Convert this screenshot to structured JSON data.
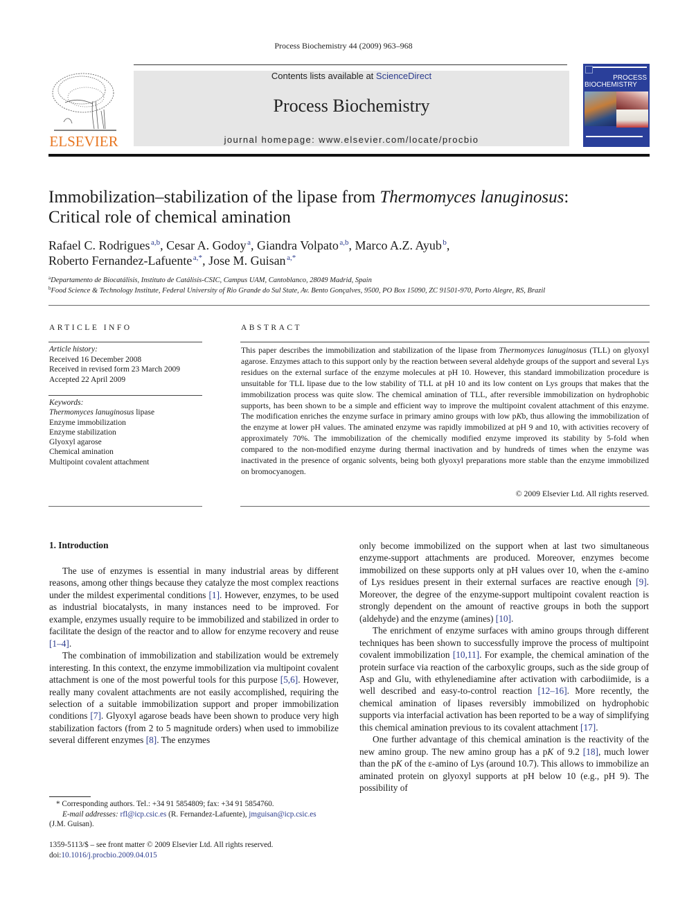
{
  "running_header": "Process Biochemistry 44 (2009) 963–968",
  "masthead": {
    "publisher_logo_text": "ELSEVIER",
    "contents_prefix": "Contents lists available at ",
    "contents_link": "ScienceDirect",
    "journal_title": "Process Biochemistry",
    "homepage": "journal homepage: www.elsevier.com/locate/procbio",
    "cover": {
      "line1": "PROCESS",
      "line2": "BIOCHEMISTRY"
    },
    "colors": {
      "logo_orange": "#e87722",
      "link_blue": "#2a3a8c",
      "box_gray": "#e6e6e6",
      "cover_blue": "#2a3f9a"
    }
  },
  "article": {
    "title_part1": "Immobilization–stabilization of the lipase from ",
    "title_italic": "Thermomyces lanuginosus",
    "title_part2": ":",
    "title_line2": "Critical role of chemical amination",
    "authors": [
      {
        "name": "Rafael C. Rodrigues",
        "sup": "a,b",
        "sep": ", "
      },
      {
        "name": "Cesar A. Godoy",
        "sup": "a",
        "sep": ", "
      },
      {
        "name": "Giandra Volpato",
        "sup": "a,b",
        "sep": ", "
      },
      {
        "name": "Marco A.Z. Ayub",
        "sup": "b",
        "sep": ","
      },
      {
        "name": "Roberto Fernandez-Lafuente",
        "sup": "a,*",
        "sep": ", "
      },
      {
        "name": "Jose M. Guisan",
        "sup": "a,*",
        "sep": ""
      }
    ],
    "affiliations": [
      {
        "key": "a",
        "text": "Departamento de Biocatálisis, Instituto de Catálisis-CSIC, Campus UAM, Cantoblanco, 28049 Madrid, Spain"
      },
      {
        "key": "b",
        "text": "Food Science & Technology Institute, Federal University of Rio Grande do Sul State, Av. Bento Gonçalves, 9500, PO Box 15090, ZC 91501-970, Porto Alegre, RS, Brazil"
      }
    ]
  },
  "article_info": {
    "heading": "ARTICLE INFO",
    "history_label": "Article history:",
    "history": [
      "Received 16 December 2008",
      "Received in revised form 23 March 2009",
      "Accepted 22 April 2009"
    ],
    "keywords_label": "Keywords:",
    "keyword_first_italic": "Thermomyces lanuginosus",
    "keyword_first_rest": " lipase",
    "keywords": [
      "Enzyme immobilization",
      "Enzyme stabilization",
      "Glyoxyl agarose",
      "Chemical amination",
      "Multipoint covalent attachment"
    ]
  },
  "abstract": {
    "heading": "ABSTRACT",
    "part1": "This paper describes the immobilization and stabilization of the lipase from ",
    "italic1": "Thermomyces lanuginosus",
    "part2": " (TLL) on glyoxyl agarose. Enzymes attach to this support only by the reaction between several aldehyde groups of the support and several Lys residues on the external surface of the enzyme molecules at pH 10. However, this standard immobilization procedure is unsuitable for TLL lipase due to the low stability of TLL at pH 10 and its low content on Lys groups that makes that the immobilization process was quite slow. The chemical amination of TLL, after reversible immobilization on hydrophobic supports, has been shown to be a simple and efficient way to improve the multipoint covalent attachment of this enzyme. The modification enriches the enzyme surface in primary amino groups with low p",
    "italic2": "K",
    "part3": "b, thus allowing the immobilization of the enzyme at lower pH values. The aminated enzyme was rapidly immobilized at pH 9 and 10, with activities recovery of approximately 70%. The immobilization of the chemically modified enzyme improved its stability by 5-fold when compared to the non-modified enzyme during thermal inactivation and by hundreds of times when the enzyme was inactivated in the presence of organic solvents, being both glyoxyl preparations more stable than the enzyme immobilized on bromocyanogen.",
    "copyright": "© 2009 Elsevier Ltd. All rights reserved."
  },
  "introduction": {
    "heading": "1. Introduction",
    "p1": [
      {
        "t": "The use of enzymes is essential in many industrial areas by different reasons, among other things because they catalyze the most complex reactions under the mildest experimental conditions "
      },
      {
        "ref": "[1]"
      },
      {
        "t": ". However, enzymes, to be used as industrial biocatalysts, in many instances need to be improved. For example, enzymes usually require to be immobilized and stabilized in order to facilitate the design of the reactor and to allow for enzyme recovery and reuse "
      },
      {
        "ref": "[1–4]"
      },
      {
        "t": "."
      }
    ],
    "p2": [
      {
        "t": "The combination of immobilization and stabilization would be extremely interesting. In this context, the enzyme immobilization via multipoint covalent attachment is one of the most powerful tools for this purpose "
      },
      {
        "ref": "[5,6]"
      },
      {
        "t": ". However, really many covalent attachments are not easily accomplished, requiring the selection of a suitable immobilization support and proper immobilization conditions "
      },
      {
        "ref": "[7]"
      },
      {
        "t": ". Glyoxyl agarose beads have been shown to produce very high stabilization factors (from 2 to 5 magnitude orders) when used to immobilize several different enzymes "
      },
      {
        "ref": "[8]"
      },
      {
        "t": ". The enzymes"
      }
    ],
    "p2_cont": [
      {
        "t": "only become immobilized on the support when at last two simultaneous enzyme-support attachments are produced. Moreover, enzymes become immobilized on these supports only at pH values over 10, when the ε-amino of Lys residues present in their external surfaces are reactive enough "
      },
      {
        "ref": "[9]"
      },
      {
        "t": ". Moreover, the degree of the enzyme-support multipoint covalent reaction is strongly dependent on the amount of reactive groups in both the support (aldehyde) and the enzyme (amines) "
      },
      {
        "ref": "[10]"
      },
      {
        "t": "."
      }
    ],
    "p3": [
      {
        "t": "The enrichment of enzyme surfaces with amino groups through different techniques has been shown to successfully improve the process of multipoint covalent immobilization "
      },
      {
        "ref": "[10,11]"
      },
      {
        "t": ". For example, the chemical amination of the protein surface via reaction of the carboxylic groups, such as the side group of Asp and Glu, with ethylenediamine after activation with carbodiimide, is a well described and easy-to-control reaction "
      },
      {
        "ref": "[12–16]"
      },
      {
        "t": ". More recently, the chemical amination of lipases reversibly immobilized on hydrophobic supports via interfacial activation has been reported to be a way of simplifying this chemical amination previous to its covalent attachment "
      },
      {
        "ref": "[17]"
      },
      {
        "t": "."
      }
    ],
    "p4": [
      {
        "t": "One further advantage of this chemical amination is the reactivity of the new amino group. The new amino group has a p"
      },
      {
        "i": "K"
      },
      {
        "t": " of 9.2 "
      },
      {
        "ref": "[18]"
      },
      {
        "t": ", much lower than the p"
      },
      {
        "i": "K"
      },
      {
        "t": " of the ε-amino of Lys (around 10.7). This allows to immobilize an aminated protein on glyoxyl supports at pH below 10 (e.g., pH 9). The possibility of"
      }
    ]
  },
  "footnotes": {
    "corresponding": "* Corresponding authors. Tel.: +34 91 5854809; fax: +34 91 5854760.",
    "email_label": "E-mail addresses:",
    "email1": "rfl@icp.csic.es",
    "email1_name": " (R. Fernandez-Lafuente), ",
    "email2": "jmguisan@icp.csic.es",
    "email2_name": "(J.M. Guisan).",
    "front_matter": "1359-5113/$ – see front matter © 2009 Elsevier Ltd. All rights reserved.",
    "doi_prefix": "doi:",
    "doi": "10.1016/j.procbio.2009.04.015"
  }
}
